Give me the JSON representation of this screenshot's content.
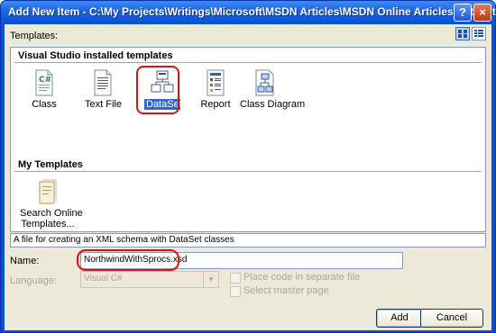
{
  "window": {
    "title": "Add New Item - C:\\My Projects\\Writings\\Microsoft\\MSDN Articles\\MSDN Online Articles\\DataTutori...",
    "help_glyph": "?",
    "close_glyph": "×"
  },
  "templates_label": "Templates:",
  "sections": {
    "installed": "Visual Studio installed templates",
    "my": "My Templates"
  },
  "installed_templates": [
    {
      "label": "Class",
      "icon": "class-icon"
    },
    {
      "label": "Text File",
      "icon": "text-file-icon"
    },
    {
      "label": "DataSet",
      "icon": "dataset-icon",
      "selected": true
    },
    {
      "label": "Report",
      "icon": "report-icon"
    },
    {
      "label": "Class Diagram",
      "icon": "class-diagram-icon"
    }
  ],
  "my_templates": [
    {
      "label_line1": "Search Online",
      "label_line2": "Templates...",
      "icon": "search-online-icon"
    }
  ],
  "description": "A file for creating an XML schema with DataSet classes",
  "form": {
    "name_label": "Name:",
    "name_value": "NorthwindWithSprocs.xsd",
    "language_label": "Language:",
    "language_value": "Visual C#",
    "place_code_label": "Place code in separate file",
    "master_page_label": "Select master page"
  },
  "buttons": {
    "add": "Add",
    "cancel": "Cancel"
  },
  "colors": {
    "titlebar": "#0b4fd4",
    "dialog_bg": "#ece9d8",
    "highlight_ring": "#e01010"
  }
}
